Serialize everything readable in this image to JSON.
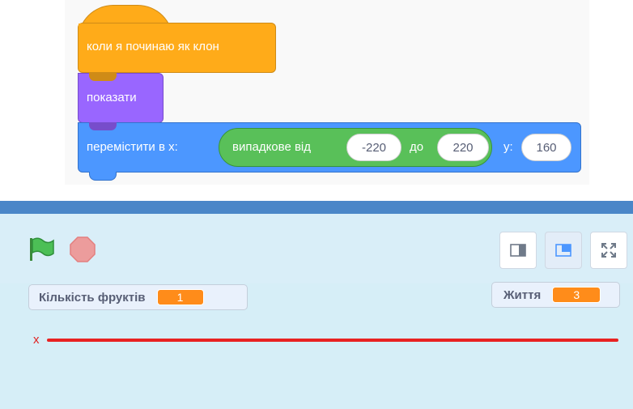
{
  "code": {
    "hat_block": {
      "label": "коли я починаю як клон",
      "color": "#ffab19"
    },
    "looks_block": {
      "label": "показати",
      "color": "#9966ff"
    },
    "motion_block": {
      "label_prefix": "перемістити в x:",
      "operator": {
        "label": "випадкове від",
        "from": "-220",
        "to_label": "до",
        "to": "220",
        "color": "#59c059"
      },
      "y_label": "y:",
      "y_value": "160",
      "color": "#4c97ff"
    }
  },
  "stage": {
    "controls": {
      "green_flag_icon": "green-flag-icon",
      "stop_icon": "stop-icon",
      "view_buttons": [
        "small-stage-icon",
        "normal-stage-icon",
        "fullscreen-icon"
      ]
    },
    "monitors": [
      {
        "label": "Кількість фруктів",
        "value": "1"
      },
      {
        "label": "Життя",
        "value": "3"
      }
    ],
    "line_label": "x",
    "line_color": "#e82222"
  }
}
